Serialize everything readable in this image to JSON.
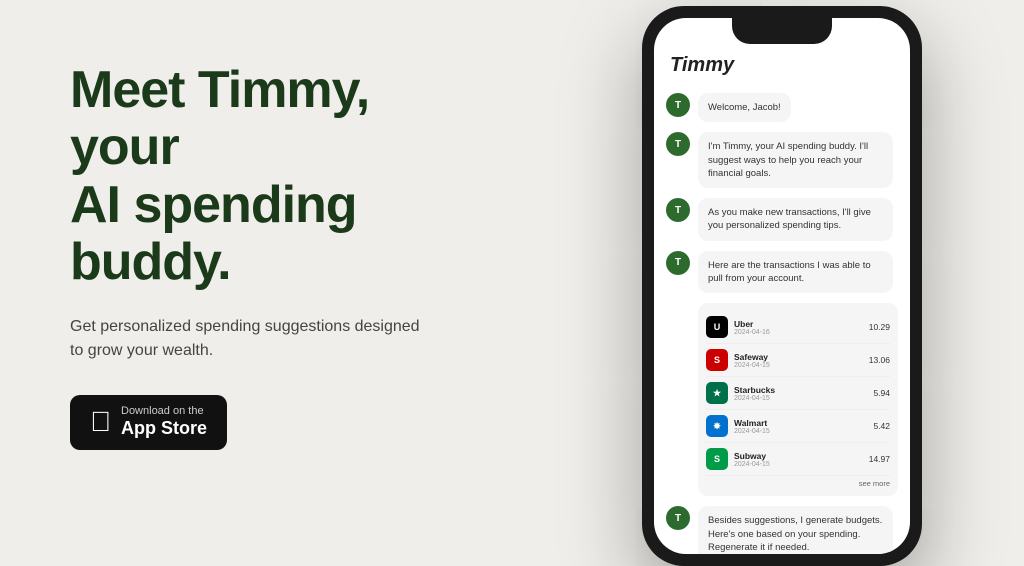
{
  "left": {
    "headline_line1": "Meet Timmy, your",
    "headline_line2": "AI spending buddy.",
    "subtext": "Get personalized spending suggestions designed to grow your wealth.",
    "app_store_button": {
      "download_on": "Download on the",
      "store_name": "App Store"
    }
  },
  "phone": {
    "app_name": "Timmy",
    "messages": [
      {
        "text": "Welcome, Jacob!"
      },
      {
        "text": "I'm Timmy, your AI spending buddy. I'll suggest ways to help you reach your financial goals."
      },
      {
        "text": "As you make new transactions, I'll give you personalized spending tips."
      },
      {
        "text": "Here are the transactions I was able to pull from your account."
      }
    ],
    "transactions": [
      {
        "name": "Uber",
        "date": "2024-04-16",
        "amount": "10.29",
        "logo": "uber"
      },
      {
        "name": "Safeway",
        "date": "2024-04-15",
        "amount": "13.06",
        "logo": "safeway"
      },
      {
        "name": "Starbucks",
        "date": "2024-04-15",
        "amount": "5.94",
        "logo": "starbucks"
      },
      {
        "name": "Walmart",
        "date": "2024-04-15",
        "amount": "5.42",
        "logo": "walmart"
      },
      {
        "name": "Subway",
        "date": "2024-04-15",
        "amount": "14.97",
        "logo": "subway"
      }
    ],
    "see_more": "see more",
    "bottom_message": "Besides suggestions, I generate budgets. Here's one based on your spending. Regenerate it if needed.",
    "colors": {
      "accent": "#2d6a2d"
    }
  }
}
